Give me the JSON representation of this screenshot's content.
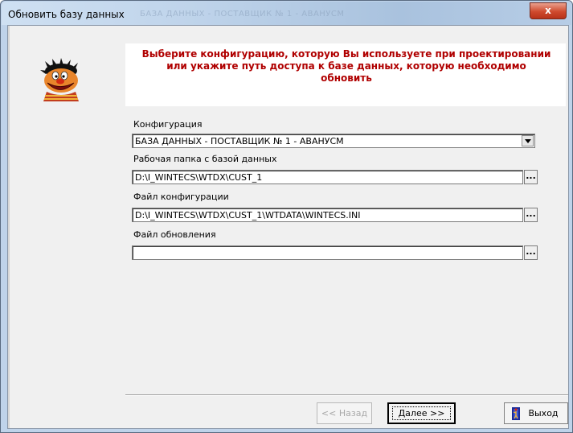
{
  "window": {
    "title": "Обновить базу данных",
    "title_ghost": "БАЗА ДАННЫХ - ПОСТАВЩИК № 1 - АВАНУСМ",
    "close_label": "x"
  },
  "banner": {
    "text": "Выберите конфигурацию, которую Вы используете при проектировании или укажите путь доступа к базе данных, которую необходимо обновить",
    "color": "#b00000"
  },
  "form": {
    "config_label": "Конфигурация",
    "config_value": "БАЗА ДАННЫХ - ПОСТАВЩИК № 1 - АВАНУСМ",
    "workdir_label": "Рабочая папка с базой данных",
    "workdir_value": "D:\\I_WINTECS\\WTDX\\CUST_1",
    "configfile_label": "Файл конфигурации",
    "configfile_value": "D:\\I_WINTECS\\WTDX\\CUST_1\\WTDATA\\WINTECS.INI",
    "updatefile_label": "Файл обновления",
    "updatefile_value": "",
    "browse_label": "..."
  },
  "buttons": {
    "back": "<< Назад",
    "next": "Далее >>",
    "exit": "Выход"
  },
  "icons": {
    "mascot": "cartoon-face-icon",
    "exit": "exit-door-icon",
    "dropdown": "chevron-down-icon"
  }
}
